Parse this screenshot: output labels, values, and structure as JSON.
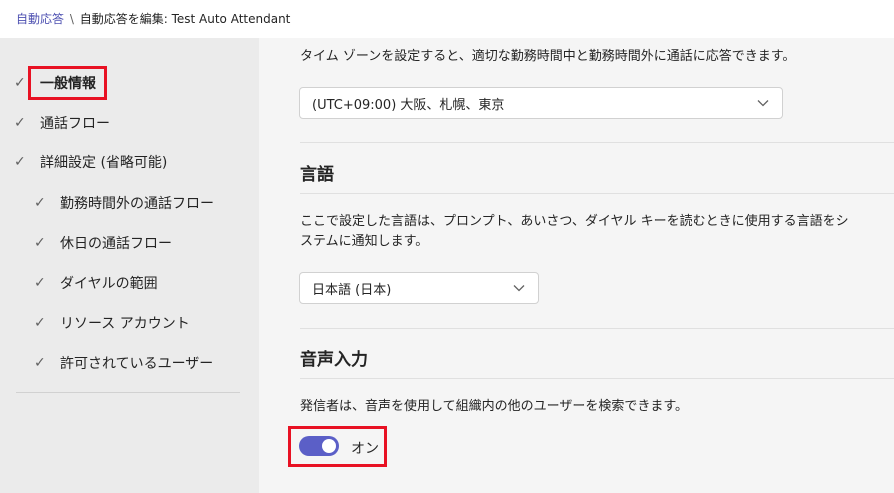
{
  "breadcrumb": {
    "root": "自動応答",
    "separator": "\\",
    "current": "自動応答を編集: Test Auto Attendant"
  },
  "sidebar": {
    "items": [
      {
        "label": "一般情報",
        "checked": true,
        "active": true
      },
      {
        "label": "通話フロー",
        "checked": true
      },
      {
        "label": "詳細設定 (省略可能)",
        "checked": true
      },
      {
        "label": "勤務時間外の通話フロー",
        "checked": true
      },
      {
        "label": "休日の通話フロー",
        "checked": true
      },
      {
        "label": "ダイヤルの範囲",
        "checked": true
      },
      {
        "label": "リソース アカウント",
        "checked": true
      },
      {
        "label": "許可されているユーザー",
        "checked": true
      }
    ]
  },
  "main": {
    "timezone": {
      "description": "タイム ゾーンを設定すると、適切な勤務時間中と勤務時間外に通話に応答できます。",
      "value": "(UTC+09:00) 大阪、札幌、東京"
    },
    "language": {
      "heading": "言語",
      "description_line1": "ここで設定した言語は、プロンプト、あいさつ、ダイヤル キーを読むときに使用する言語をシ",
      "description_line2": "ステムに通知します。",
      "value": "日本語 (日本)"
    },
    "voice_input": {
      "heading": "音声入力",
      "description": "発信者は、音声を使用して組織内の他のユーザーを検索できます。",
      "toggle_label": "オン",
      "toggle_on": true
    }
  },
  "colors": {
    "accent": "#5b5fc7",
    "highlight": "#e81123",
    "link": "#4f52b2"
  }
}
